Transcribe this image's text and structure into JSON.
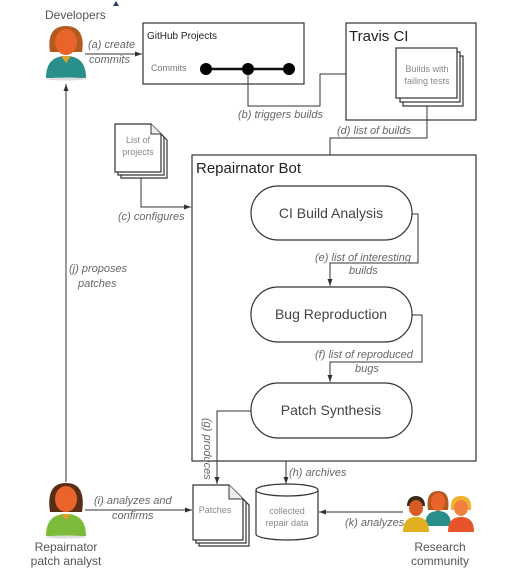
{
  "actors": {
    "developers": {
      "label": "Developers",
      "colors": {
        "hair": "#b35a1f",
        "skin": "#e8642a",
        "shirt": "#2a8f8a"
      }
    },
    "analyst": {
      "label_line1": "Repairnator",
      "label_line2": "patch analyst",
      "colors": {
        "hair": "#5a2e16",
        "skin": "#e8642a",
        "shirt": "#7cbc3a"
      }
    },
    "research": {
      "label_line1": "Research",
      "label_line2": "community",
      "colors": {
        "shirt1": "#e0b020",
        "shirt2": "#2a8f8a",
        "shirt3": "#e8542a"
      }
    }
  },
  "boxes": {
    "github": {
      "title": "GitHub Projects",
      "commits_label": "Commits"
    },
    "travis": {
      "title": "Travis CI",
      "builds_line1": "Builds with",
      "builds_line2": "failing tests"
    },
    "projects_doc": {
      "line1": "List of",
      "line2": "projects"
    },
    "bot": {
      "title": "Repairnator Bot"
    },
    "patches_doc": {
      "label": "Patches"
    },
    "repair_data": {
      "line1": "collected",
      "line2": "repair data"
    }
  },
  "stages": [
    {
      "label": "CI Build Analysis"
    },
    {
      "label": "Bug Reproduction"
    },
    {
      "label": "Patch Synthesis"
    }
  ],
  "edges": {
    "a": {
      "line1": "(a) create",
      "line2": "commits"
    },
    "b": {
      "line1": "(b) triggers builds"
    },
    "c": {
      "line1": "(c) configures"
    },
    "d": {
      "line1": "(d) list of builds"
    },
    "e": {
      "line1": "(e) list of interesting",
      "line2": "builds"
    },
    "f": {
      "line1": "(f) list of reproduced",
      "line2": "bugs"
    },
    "g": {
      "line1": "(g) produces"
    },
    "h": {
      "line1": "(h) archives"
    },
    "i": {
      "line1": "(i) analyzes and",
      "line2": "confirms"
    },
    "j": {
      "line1": "(j) proposes",
      "line2": "patches"
    },
    "k": {
      "line1": "(k) analyzes"
    }
  }
}
